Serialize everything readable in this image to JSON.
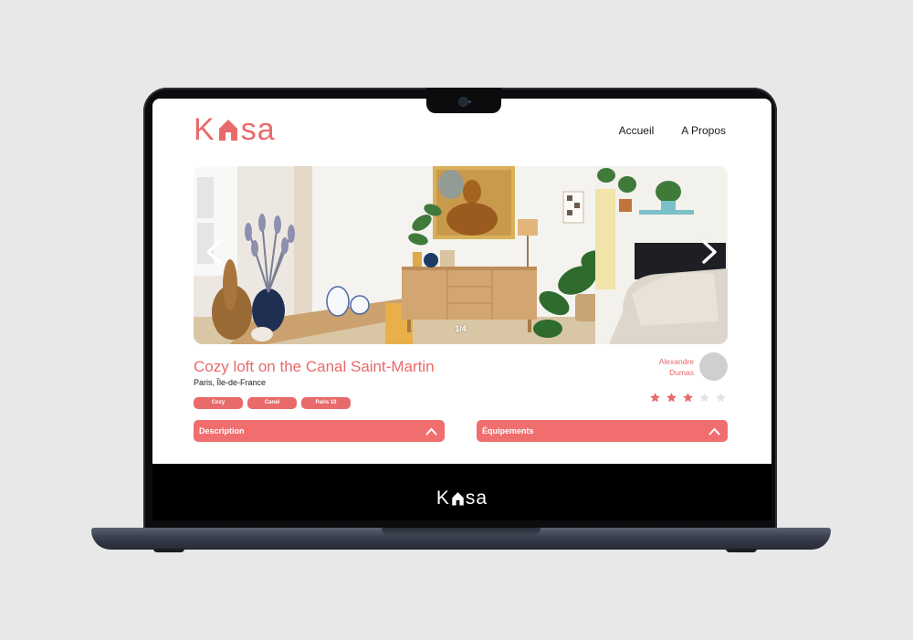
{
  "brand": {
    "logo_pre": "K",
    "logo_post": "sa",
    "accent_color": "#e86a6a",
    "footer_logo_pre": "K",
    "footer_logo_post": "sa"
  },
  "nav": {
    "home": "Accueil",
    "about": "A Propos"
  },
  "gallery": {
    "counter": "1/4",
    "prev_icon": "chevron-left-icon",
    "next_icon": "chevron-right-icon"
  },
  "listing": {
    "title": "Cozy loft on the Canal Saint-Martin",
    "location": "Paris, Île-de-France",
    "tags": [
      "Cozy",
      "Canal",
      "Paris 10"
    ],
    "host_first": "Alexandre",
    "host_last": "Dumas",
    "rating": 3,
    "rating_max": 5
  },
  "sections": {
    "description": "Description",
    "equipment": "Équipements"
  }
}
